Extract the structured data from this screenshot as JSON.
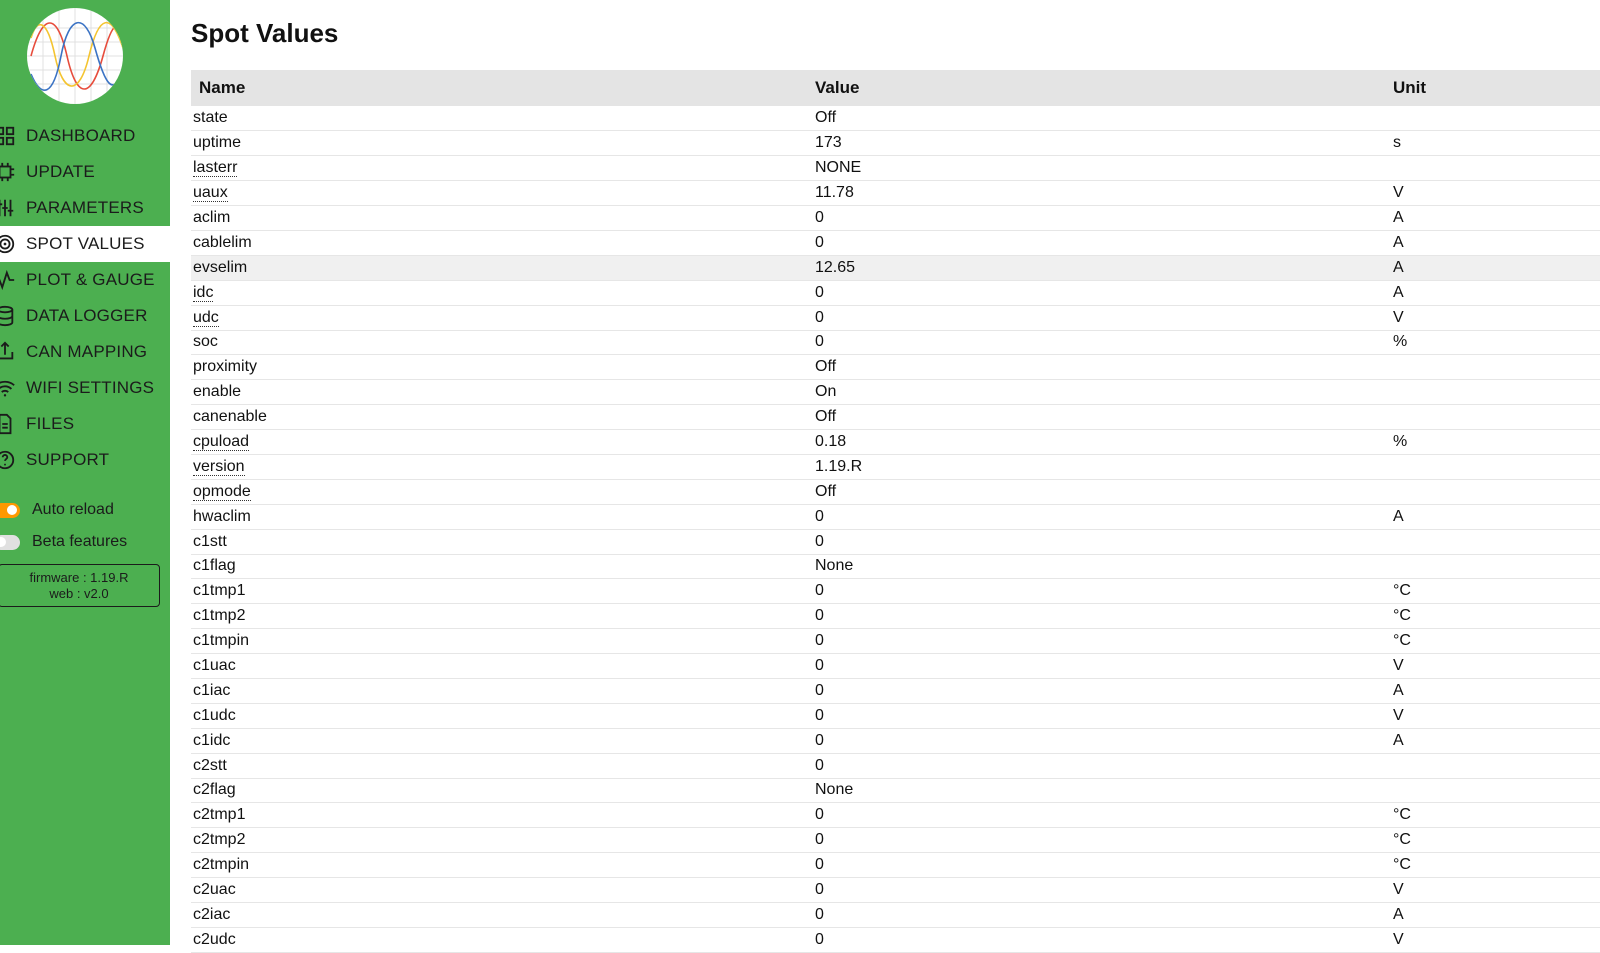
{
  "nav": {
    "items": [
      {
        "label": "DASHBOARD",
        "icon": "dashboard-icon"
      },
      {
        "label": "UPDATE",
        "icon": "chip-icon"
      },
      {
        "label": "PARAMETERS",
        "icon": "sliders-icon"
      },
      {
        "label": "SPOT VALUES",
        "icon": "target-icon",
        "active": true
      },
      {
        "label": "PLOT & GAUGE",
        "icon": "pulse-icon"
      },
      {
        "label": "DATA LOGGER",
        "icon": "database-icon"
      },
      {
        "label": "CAN MAPPING",
        "icon": "share-icon"
      },
      {
        "label": "WIFI SETTINGS",
        "icon": "wifi-icon"
      },
      {
        "label": "FILES",
        "icon": "file-icon"
      },
      {
        "label": "SUPPORT",
        "icon": "help-icon"
      }
    ]
  },
  "settings": {
    "auto_reload": {
      "label": "Auto reload",
      "enabled": true
    },
    "beta_features": {
      "label": "Beta features",
      "enabled": false
    }
  },
  "version": {
    "firmware": "firmware : 1.19.R",
    "web": "web : v2.0"
  },
  "colors": {
    "sidebar": "#4caf50",
    "toggle_on": "#ff9800",
    "header_bg": "#e4e4e4"
  },
  "page": {
    "title": "Spot Values"
  },
  "table": {
    "headers": [
      "Name",
      "Value",
      "Unit"
    ],
    "rows": [
      {
        "name": "state",
        "value": "Off",
        "unit": ""
      },
      {
        "name": "uptime",
        "value": "173",
        "unit": "s"
      },
      {
        "name": "lasterr",
        "value": "NONE",
        "unit": "",
        "dotted": true
      },
      {
        "name": "uaux",
        "value": "11.78",
        "unit": "V",
        "dotted": true
      },
      {
        "name": "aclim",
        "value": "0",
        "unit": "A"
      },
      {
        "name": "cablelim",
        "value": "0",
        "unit": "A"
      },
      {
        "name": "evselim",
        "value": "12.65",
        "unit": "A",
        "highlight": true
      },
      {
        "name": "idc",
        "value": "0",
        "unit": "A",
        "dotted": true
      },
      {
        "name": "udc",
        "value": "0",
        "unit": "V",
        "dotted": true
      },
      {
        "name": "soc",
        "value": "0",
        "unit": "%"
      },
      {
        "name": "proximity",
        "value": "Off",
        "unit": ""
      },
      {
        "name": "enable",
        "value": "On",
        "unit": ""
      },
      {
        "name": "canenable",
        "value": "Off",
        "unit": ""
      },
      {
        "name": "cpuload",
        "value": "0.18",
        "unit": "%",
        "dotted": true
      },
      {
        "name": "version",
        "value": "1.19.R",
        "unit": "",
        "dotted": true
      },
      {
        "name": "opmode",
        "value": "Off",
        "unit": "",
        "dotted": true
      },
      {
        "name": "hwaclim",
        "value": "0",
        "unit": "A"
      },
      {
        "name": "c1stt",
        "value": "0",
        "unit": ""
      },
      {
        "name": "c1flag",
        "value": "None",
        "unit": ""
      },
      {
        "name": "c1tmp1",
        "value": "0",
        "unit": "°C"
      },
      {
        "name": "c1tmp2",
        "value": "0",
        "unit": "°C"
      },
      {
        "name": "c1tmpin",
        "value": "0",
        "unit": "°C"
      },
      {
        "name": "c1uac",
        "value": "0",
        "unit": "V"
      },
      {
        "name": "c1iac",
        "value": "0",
        "unit": "A"
      },
      {
        "name": "c1udc",
        "value": "0",
        "unit": "V"
      },
      {
        "name": "c1idc",
        "value": "0",
        "unit": "A"
      },
      {
        "name": "c2stt",
        "value": "0",
        "unit": ""
      },
      {
        "name": "c2flag",
        "value": "None",
        "unit": ""
      },
      {
        "name": "c2tmp1",
        "value": "0",
        "unit": "°C"
      },
      {
        "name": "c2tmp2",
        "value": "0",
        "unit": "°C"
      },
      {
        "name": "c2tmpin",
        "value": "0",
        "unit": "°C"
      },
      {
        "name": "c2uac",
        "value": "0",
        "unit": "V"
      },
      {
        "name": "c2iac",
        "value": "0",
        "unit": "A"
      },
      {
        "name": "c2udc",
        "value": "0",
        "unit": "V"
      }
    ]
  }
}
